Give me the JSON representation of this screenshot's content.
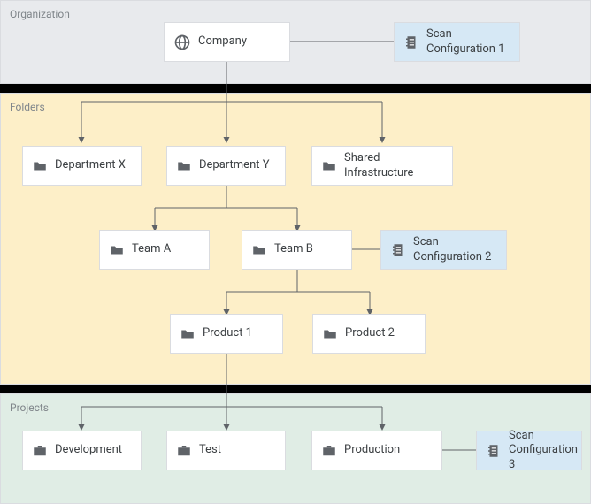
{
  "labels": {
    "organization": "Organization",
    "folders": "Folders",
    "projects": "Projects"
  },
  "nodes": {
    "company": "Company",
    "scan1": "Scan\nConfiguration 1",
    "dept_x": "Department X",
    "dept_y": "Department Y",
    "shared": "Shared\nInfrastructure",
    "team_a": "Team A",
    "team_b": "Team B",
    "scan2": "Scan\nConfiguration 2",
    "product1": "Product 1",
    "product2": "Product 2",
    "development": "Development",
    "test": "Test",
    "production": "Production",
    "scan3": "Scan\nConfiguration 3"
  },
  "colors": {
    "org_band": "#e8eaed",
    "folders_band": "#fdefc8",
    "projects_band": "#e0ede5",
    "scan_bg": "#d6e8f5",
    "node_border": "#dadce0",
    "icon": "#5f6368"
  },
  "chart_data": {
    "type": "tree",
    "title": "",
    "nodes": [
      {
        "id": "company",
        "label": "Company",
        "layer": "Organization",
        "kind": "org"
      },
      {
        "id": "scan1",
        "label": "Scan Configuration 1",
        "layer": "Organization",
        "kind": "scan",
        "attached_to": "company"
      },
      {
        "id": "dept_x",
        "label": "Department X",
        "layer": "Folders",
        "kind": "folder"
      },
      {
        "id": "dept_y",
        "label": "Department Y",
        "layer": "Folders",
        "kind": "folder"
      },
      {
        "id": "shared",
        "label": "Shared Infrastructure",
        "layer": "Folders",
        "kind": "folder"
      },
      {
        "id": "team_a",
        "label": "Team A",
        "layer": "Folders",
        "kind": "folder"
      },
      {
        "id": "team_b",
        "label": "Team B",
        "layer": "Folders",
        "kind": "folder"
      },
      {
        "id": "scan2",
        "label": "Scan Configuration 2",
        "layer": "Folders",
        "kind": "scan",
        "attached_to": "team_b"
      },
      {
        "id": "product1",
        "label": "Product 1",
        "layer": "Folders",
        "kind": "folder"
      },
      {
        "id": "product2",
        "label": "Product 2",
        "layer": "Folders",
        "kind": "folder"
      },
      {
        "id": "development",
        "label": "Development",
        "layer": "Projects",
        "kind": "project"
      },
      {
        "id": "test",
        "label": "Test",
        "layer": "Projects",
        "kind": "project"
      },
      {
        "id": "production",
        "label": "Production",
        "layer": "Projects",
        "kind": "project"
      },
      {
        "id": "scan3",
        "label": "Scan Configuration 3",
        "layer": "Projects",
        "kind": "scan",
        "attached_to": "production"
      }
    ],
    "edges": [
      {
        "from": "company",
        "to": "dept_x"
      },
      {
        "from": "company",
        "to": "dept_y"
      },
      {
        "from": "company",
        "to": "shared"
      },
      {
        "from": "dept_y",
        "to": "team_a"
      },
      {
        "from": "dept_y",
        "to": "team_b"
      },
      {
        "from": "team_b",
        "to": "product1"
      },
      {
        "from": "team_b",
        "to": "product2"
      },
      {
        "from": "product1",
        "to": "development"
      },
      {
        "from": "product1",
        "to": "test"
      },
      {
        "from": "product1",
        "to": "production"
      },
      {
        "from": "company",
        "to": "scan1",
        "style": "side"
      },
      {
        "from": "team_b",
        "to": "scan2",
        "style": "side"
      },
      {
        "from": "production",
        "to": "scan3",
        "style": "side"
      }
    ]
  }
}
